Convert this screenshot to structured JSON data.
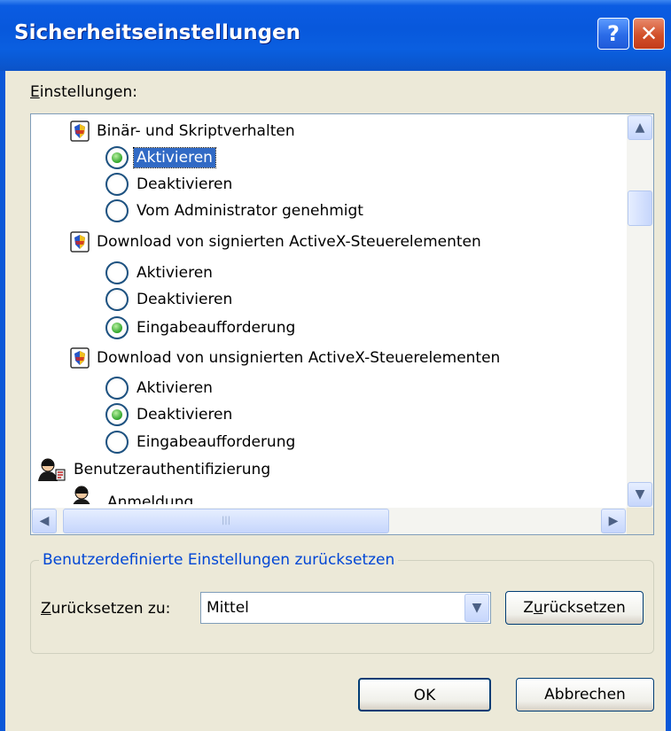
{
  "window": {
    "title": "Sicherheitseinstellungen",
    "help_button": "?",
    "close_button": "✕"
  },
  "settings_label_prefix": "E",
  "settings_label_rest": "instellungen:",
  "tree": {
    "binary": {
      "label": "Binär- und Skriptverhalten",
      "options": [
        {
          "label": "Aktivieren",
          "selected": true
        },
        {
          "label": "Deaktivieren",
          "selected": false
        },
        {
          "label": "Vom Administrator genehmigt",
          "selected": false
        }
      ]
    },
    "signed": {
      "label": "Download von signierten ActiveX-Steuerelementen",
      "options": [
        {
          "label": "Aktivieren",
          "selected": false
        },
        {
          "label": "Deaktivieren",
          "selected": false
        },
        {
          "label": "Eingabeaufforderung",
          "selected": true
        }
      ]
    },
    "unsigned": {
      "label": "Download von unsignierten ActiveX-Steuerelementen",
      "options": [
        {
          "label": "Aktivieren",
          "selected": false
        },
        {
          "label": "Deaktivieren",
          "selected": true
        },
        {
          "label": "Eingabeaufforderung",
          "selected": false
        }
      ]
    },
    "auth": {
      "label": "Benutzerauthentifizierung",
      "child_partial": "Anmeldung"
    }
  },
  "reset_group": {
    "legend": "Benutzerdefinierte Einstellungen zurücksetzen",
    "reset_to_prefix": "Z",
    "reset_to_rest": "urücksetzen zu:",
    "combo_value": "Mittel",
    "reset_button_prefix": "Z",
    "reset_button_u": "u",
    "reset_button_rest": "rücksetzen"
  },
  "buttons": {
    "ok": "OK",
    "cancel": "Abbrechen"
  },
  "colors": {
    "titlebar": "#0858dc",
    "selection": "#316ac5",
    "radio_on": "#2fa42a",
    "legend_text": "#0046d5"
  }
}
